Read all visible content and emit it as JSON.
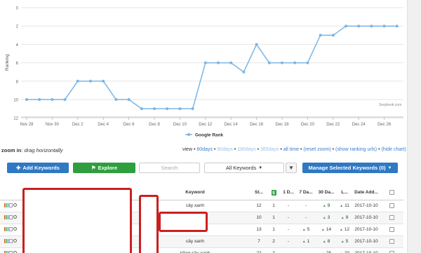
{
  "chart_data": {
    "type": "line",
    "categories": [
      "Nov 27",
      "Nov 28",
      "Nov 29",
      "Nov 30",
      "Dec 1",
      "Dec 2",
      "Dec 3",
      "Dec 4",
      "Dec 5",
      "Dec 6",
      "Dec 7",
      "Dec 8",
      "Dec 9",
      "Dec 10",
      "Dec 11",
      "Dec 12",
      "Dec 13",
      "Dec 14",
      "Dec 15",
      "Dec 16",
      "Dec 17",
      "Dec 18",
      "Dec 19",
      "Dec 20",
      "Dec 21",
      "Dec 22",
      "Dec 23",
      "Dec 24",
      "Dec 25",
      "Dec 26",
      "Dec 27"
    ],
    "x_tick_labels": [
      "Nov 28",
      "Nov 30",
      "Dec 2",
      "Dec 4",
      "Dec 6",
      "Dec 8",
      "Dec 10",
      "Dec 12",
      "Dec 14",
      "Dec 16",
      "Dec 18",
      "Dec 20",
      "Dec 22",
      "Dec 24",
      "Dec 26"
    ],
    "series": [
      {
        "name": "Google Rank",
        "color": "#7cb5e4",
        "values": [
          10,
          10,
          10,
          10,
          8,
          8,
          8,
          10,
          10,
          11,
          11,
          11,
          11,
          11,
          6,
          6,
          6,
          7,
          4,
          6,
          6,
          6,
          6,
          3,
          3,
          2,
          2,
          2,
          2,
          2
        ]
      }
    ],
    "ylabel": "Ranking",
    "y_ticks": [
      0,
      2,
      4,
      6,
      8,
      10,
      12
    ],
    "ylim": [
      0,
      12
    ],
    "y_reversed": true,
    "grid": true,
    "legend": "bottom-center"
  },
  "credit": "Serpbook.com",
  "zoom": {
    "label": "zoom in",
    "hint": "drag horizontally"
  },
  "view": {
    "prefix": "view •",
    "days60": "60days",
    "days90": "90days",
    "days180": "180days",
    "days365": "365days",
    "alltime": "all time",
    "reset": "(reset zoom)",
    "ranking_urls": "(show ranking urls)",
    "hide_chart": "(hide chart)"
  },
  "toolbar": {
    "add_keywords": "Add Keywords",
    "explore": "Explore",
    "search_placeholder": "Search",
    "all_keywords": "All Keywords",
    "manage": "Manage Selected Keywords (0)"
  },
  "table": {
    "headers": {
      "keyword": "Keyword",
      "start": "St...",
      "day1": "1 D...",
      "day7": "7 Da...",
      "day30": "30 Da...",
      "life": "L...",
      "date_added": "Date Add..."
    },
    "rows": [
      {
        "keyword": "cây xanh",
        "start": "12",
        "google": "1",
        "day1": "-",
        "day7": "-",
        "day30": "9",
        "life": "11",
        "date": "2017-10-10"
      },
      {
        "keyword": "",
        "start": "10",
        "google": "1",
        "day1": "-",
        "day7": "-",
        "day30": "3",
        "life": "9",
        "date": "2017-10-10"
      },
      {
        "keyword": "cây xanh",
        "start": "13",
        "google": "1",
        "day1": "-",
        "day7": "5",
        "day30": "14",
        "life": "12",
        "date": "2017-10-10"
      },
      {
        "keyword": "cây xanh",
        "start": "7",
        "google": "2",
        "day1": "-",
        "day7": "1",
        "day30": "8",
        "life": "5",
        "date": "2017-10-10"
      },
      {
        "keyword": "trồng cây xanh",
        "start": "22",
        "google": "2",
        "day1": "-",
        "day7": "-",
        "day30": "25",
        "life": "20",
        "date": "2017-10-10"
      }
    ]
  }
}
